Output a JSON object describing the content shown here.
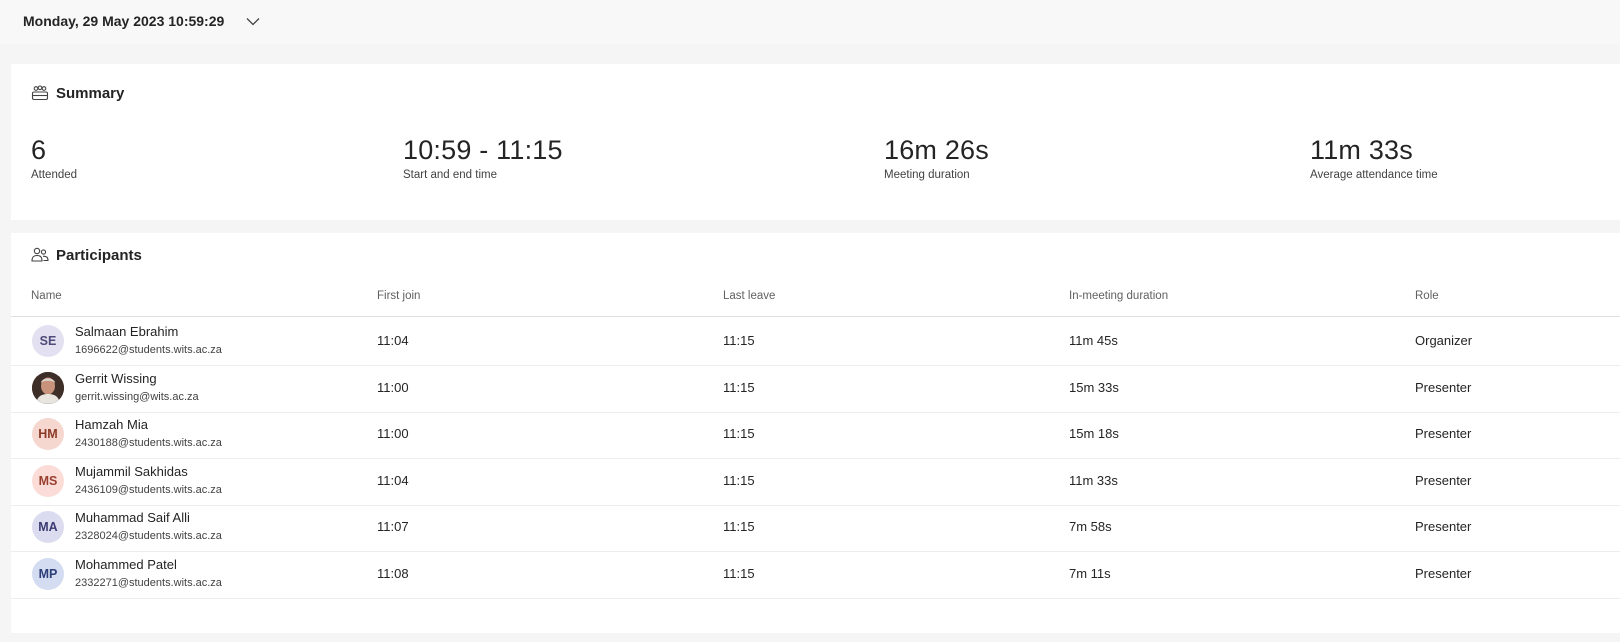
{
  "header": {
    "datetime": "Monday, 29 May 2023 10:59:29"
  },
  "summary": {
    "title": "Summary",
    "stats": [
      {
        "value": "6",
        "label": "Attended"
      },
      {
        "value": "10:59 - 11:15",
        "label": "Start and end time"
      },
      {
        "value": "16m 26s",
        "label": "Meeting duration"
      },
      {
        "value": "11m 33s",
        "label": "Average attendance time"
      }
    ]
  },
  "participants": {
    "title": "Participants",
    "columns": [
      "Name",
      "First join",
      "Last leave",
      "In-meeting duration",
      "Role"
    ],
    "rows": [
      {
        "initials": "SE",
        "name": "Salmaan Ebrahim",
        "email": "1696622@students.wits.ac.za",
        "first_join": "11:04",
        "last_leave": "11:15",
        "duration": "11m 45s",
        "role": "Organizer",
        "avatar_bg": "#e3e1f1",
        "avatar_fg": "#4f4a7a"
      },
      {
        "initials": "",
        "name": "Gerrit Wissing",
        "email": "gerrit.wissing@wits.ac.za",
        "first_join": "11:00",
        "last_leave": "11:15",
        "duration": "15m 33s",
        "role": "Presenter",
        "avatar_bg": "#4a3a30",
        "avatar_fg": "#ffffff"
      },
      {
        "initials": "HM",
        "name": "Hamzah Mia",
        "email": "2430188@students.wits.ac.za",
        "first_join": "11:00",
        "last_leave": "11:15",
        "duration": "15m 18s",
        "role": "Presenter",
        "avatar_bg": "#f6d7cf",
        "avatar_fg": "#8a3a27"
      },
      {
        "initials": "MS",
        "name": "Mujammil Sakhidas",
        "email": "2436109@students.wits.ac.za",
        "first_join": "11:04",
        "last_leave": "11:15",
        "duration": "11m 33s",
        "role": "Presenter",
        "avatar_bg": "#fbdcd6",
        "avatar_fg": "#9a3f30"
      },
      {
        "initials": "MA",
        "name": "Muhammad Saif Alli",
        "email": "2328024@students.wits.ac.za",
        "first_join": "11:07",
        "last_leave": "11:15",
        "duration": "7m 58s",
        "role": "Presenter",
        "avatar_bg": "#dcdcf0",
        "avatar_fg": "#3b3a72"
      },
      {
        "initials": "MP",
        "name": "Mohammed Patel",
        "email": "2332271@students.wits.ac.za",
        "first_join": "11:08",
        "last_leave": "11:15",
        "duration": "7m 11s",
        "role": "Presenter",
        "avatar_bg": "#d3dcf1",
        "avatar_fg": "#2c3f78"
      }
    ]
  }
}
